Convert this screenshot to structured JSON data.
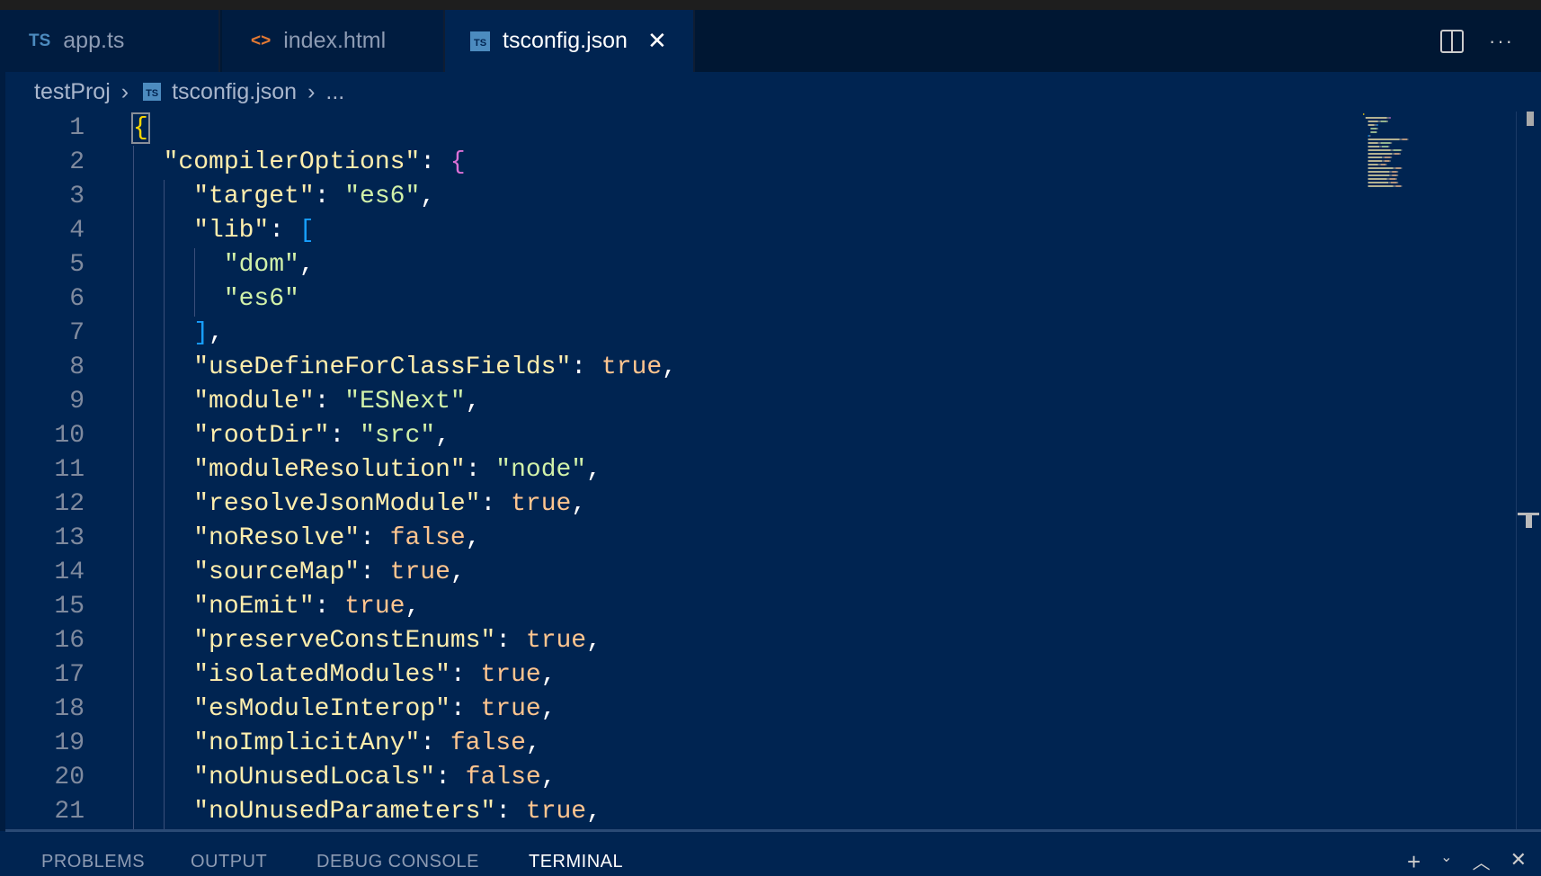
{
  "tabs": [
    {
      "label": "app.ts",
      "icon": "typescript-icon",
      "icon_text": "TS",
      "icon_color": "#4c8bbf",
      "active": false
    },
    {
      "label": "index.html",
      "icon": "html-code-icon",
      "icon_text": "<>",
      "icon_color": "#e37933",
      "active": false
    },
    {
      "label": "tsconfig.json",
      "icon": "tsconfig-icon",
      "icon_text": "TS",
      "active": true
    }
  ],
  "breadcrumb": {
    "folder": "testProj",
    "file": "tsconfig.json",
    "rest": "..."
  },
  "colors": {
    "editor_bg": "#002451",
    "key": "#ffeead",
    "string": "#d1f1a9",
    "boolean": "#ffc58f",
    "bracket1": "#ffd700",
    "bracket2": "#da70d6",
    "bracket3": "#179fff"
  },
  "lines": [
    [
      [
        "br1",
        "{"
      ]
    ],
    [
      [
        "p",
        "  "
      ],
      [
        "k",
        "\"compilerOptions\""
      ],
      [
        "p",
        ": "
      ],
      [
        "br2",
        "{"
      ]
    ],
    [
      [
        "p",
        "    "
      ],
      [
        "k",
        "\"target\""
      ],
      [
        "p",
        ": "
      ],
      [
        "s",
        "\"es6\""
      ],
      [
        "p",
        ","
      ]
    ],
    [
      [
        "p",
        "    "
      ],
      [
        "k",
        "\"lib\""
      ],
      [
        "p",
        ": "
      ],
      [
        "br3",
        "["
      ]
    ],
    [
      [
        "p",
        "      "
      ],
      [
        "s",
        "\"dom\""
      ],
      [
        "p",
        ","
      ]
    ],
    [
      [
        "p",
        "      "
      ],
      [
        "s",
        "\"es6\""
      ]
    ],
    [
      [
        "p",
        "    "
      ],
      [
        "br3",
        "]"
      ],
      [
        "p",
        ","
      ]
    ],
    [
      [
        "p",
        "    "
      ],
      [
        "k",
        "\"useDefineForClassFields\""
      ],
      [
        "p",
        ": "
      ],
      [
        "b",
        "true"
      ],
      [
        "p",
        ","
      ]
    ],
    [
      [
        "p",
        "    "
      ],
      [
        "k",
        "\"module\""
      ],
      [
        "p",
        ": "
      ],
      [
        "s",
        "\"ESNext\""
      ],
      [
        "p",
        ","
      ]
    ],
    [
      [
        "p",
        "    "
      ],
      [
        "k",
        "\"rootDir\""
      ],
      [
        "p",
        ": "
      ],
      [
        "s",
        "\"src\""
      ],
      [
        "p",
        ","
      ]
    ],
    [
      [
        "p",
        "    "
      ],
      [
        "k",
        "\"moduleResolution\""
      ],
      [
        "p",
        ": "
      ],
      [
        "s",
        "\"node\""
      ],
      [
        "p",
        ","
      ]
    ],
    [
      [
        "p",
        "    "
      ],
      [
        "k",
        "\"resolveJsonModule\""
      ],
      [
        "p",
        ": "
      ],
      [
        "b",
        "true"
      ],
      [
        "p",
        ","
      ]
    ],
    [
      [
        "p",
        "    "
      ],
      [
        "k",
        "\"noResolve\""
      ],
      [
        "p",
        ": "
      ],
      [
        "b",
        "false"
      ],
      [
        "p",
        ","
      ]
    ],
    [
      [
        "p",
        "    "
      ],
      [
        "k",
        "\"sourceMap\""
      ],
      [
        "p",
        ": "
      ],
      [
        "b",
        "true"
      ],
      [
        "p",
        ","
      ]
    ],
    [
      [
        "p",
        "    "
      ],
      [
        "k",
        "\"noEmit\""
      ],
      [
        "p",
        ": "
      ],
      [
        "b",
        "true"
      ],
      [
        "p",
        ","
      ]
    ],
    [
      [
        "p",
        "    "
      ],
      [
        "k",
        "\"preserveConstEnums\""
      ],
      [
        "p",
        ": "
      ],
      [
        "b",
        "true"
      ],
      [
        "p",
        ","
      ]
    ],
    [
      [
        "p",
        "    "
      ],
      [
        "k",
        "\"isolatedModules\""
      ],
      [
        "p",
        ": "
      ],
      [
        "b",
        "true"
      ],
      [
        "p",
        ","
      ]
    ],
    [
      [
        "p",
        "    "
      ],
      [
        "k",
        "\"esModuleInterop\""
      ],
      [
        "p",
        ": "
      ],
      [
        "b",
        "true"
      ],
      [
        "p",
        ","
      ]
    ],
    [
      [
        "p",
        "    "
      ],
      [
        "k",
        "\"noImplicitAny\""
      ],
      [
        "p",
        ": "
      ],
      [
        "b",
        "false"
      ],
      [
        "p",
        ","
      ]
    ],
    [
      [
        "p",
        "    "
      ],
      [
        "k",
        "\"noUnusedLocals\""
      ],
      [
        "p",
        ": "
      ],
      [
        "b",
        "false"
      ],
      [
        "p",
        ","
      ]
    ],
    [
      [
        "p",
        "    "
      ],
      [
        "k",
        "\"noUnusedParameters\""
      ],
      [
        "p",
        ": "
      ],
      [
        "b",
        "true"
      ],
      [
        "p",
        ","
      ]
    ]
  ],
  "panel": {
    "tabs": [
      "PROBLEMS",
      "OUTPUT",
      "DEBUG CONSOLE",
      "TERMINAL"
    ],
    "active": "TERMINAL"
  }
}
